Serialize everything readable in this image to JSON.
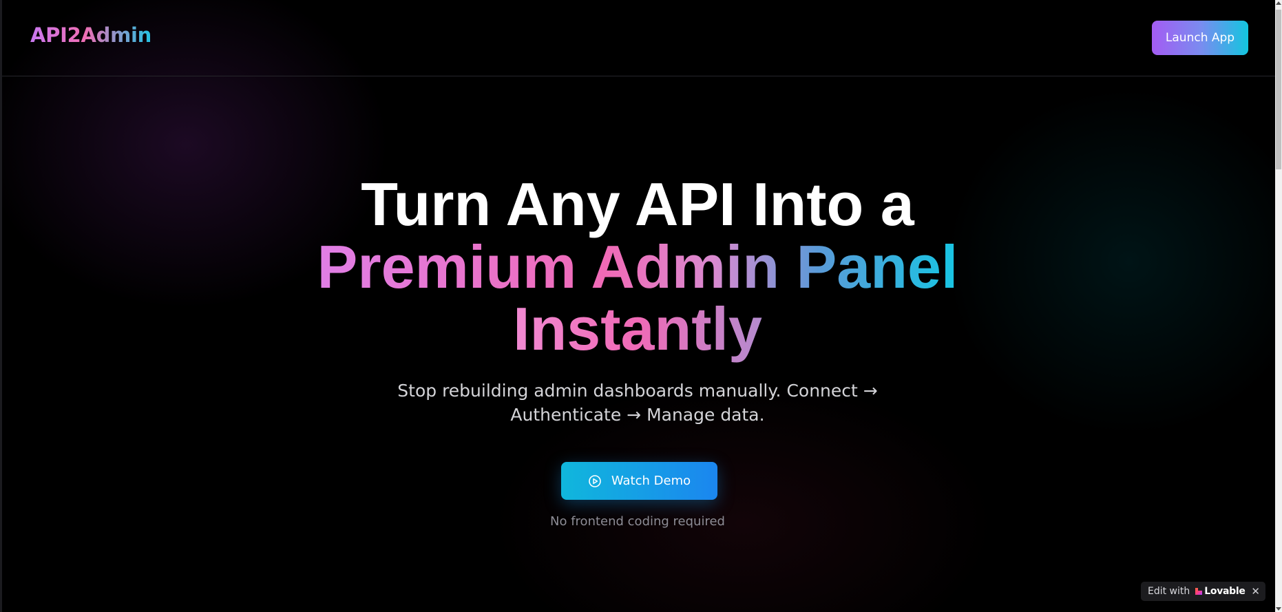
{
  "header": {
    "logo": "API2Admin",
    "launch_label": "Launch App"
  },
  "hero": {
    "line1": "Turn Any API Into a",
    "line2": "Premium Admin Panel",
    "line3": "Instantly",
    "subtitle": "Stop rebuilding admin dashboards manually. Connect → Authenticate → Manage data.",
    "demo_label": "Watch Demo",
    "demo_icon": "play-circle-icon",
    "note": "No frontend coding required"
  },
  "badge": {
    "prefix": "Edit with",
    "brand": "Lovable",
    "brand_icon": "heart-icon",
    "close": "✕"
  },
  "colors": {
    "background": "#000000",
    "accent_purple": "#a35cf2",
    "accent_pink": "#f06ab6",
    "accent_cyan": "#13c6df",
    "accent_blue": "#1b86ef"
  }
}
